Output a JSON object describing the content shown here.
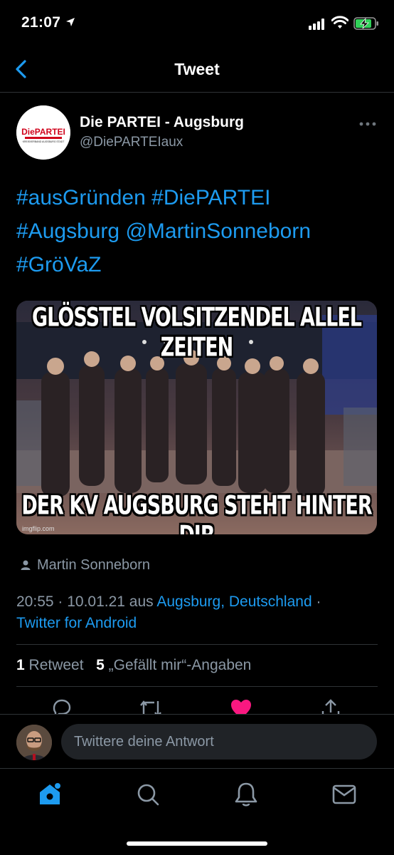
{
  "status_bar": {
    "time": "21:07"
  },
  "nav": {
    "title": "Tweet"
  },
  "author": {
    "name": "Die PARTEI - Augsburg",
    "handle": "@DiePARTEIaux",
    "logo_word": "DiePARTEI",
    "logo_sub": "KREISVERBAND AUGSBURG STADT"
  },
  "tweet": {
    "lines": [
      "#ausGründen #DiePARTEI",
      "#Augsburg @MartinSonneborn",
      "#GröVaZ"
    ]
  },
  "media": {
    "top_caption": "GLÖSSTEL VOLSITZENDEL ALLEL ZEITEN",
    "bottom_caption": "DER KV AUGSBURG STEHT HINTER DIR",
    "watermark": "imgflip.com"
  },
  "mentioned": {
    "name": "Martin Sonneborn"
  },
  "meta": {
    "datetime": "20:55 · 10.01.21 aus ",
    "location": "Augsburg, Deutschland",
    "separator": " ·",
    "client": "Twitter for Android"
  },
  "stats": {
    "retweets_count": "1",
    "retweets_label": "Retweet",
    "likes_count": "5",
    "likes_label": "„Gefällt mir“-Angaben"
  },
  "reply": {
    "placeholder": "Twittere deine Antwort"
  },
  "tabs": [
    "home-icon",
    "search-icon",
    "bell-icon",
    "mail-icon"
  ],
  "colors": {
    "accent": "#1d9bf0",
    "like": "#f91880",
    "secondary": "#8b98a5",
    "background": "#000000"
  }
}
